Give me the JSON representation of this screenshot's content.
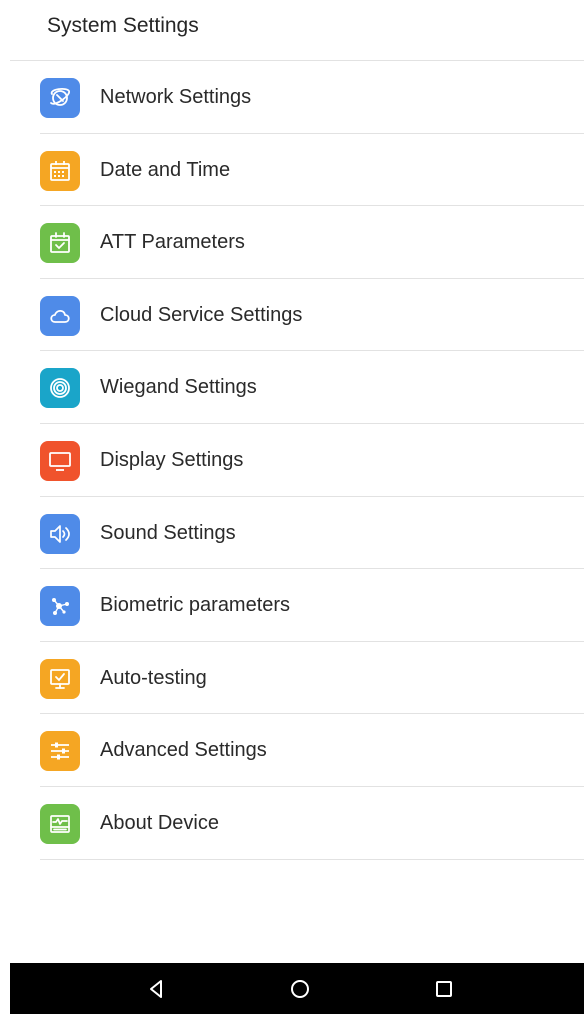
{
  "header": {
    "title": "System Settings"
  },
  "items": [
    {
      "label": "Network Settings",
      "icon": "network-icon",
      "color": "#4f8be8"
    },
    {
      "label": "Date and Time",
      "icon": "calendar-icon",
      "color": "#f5a623"
    },
    {
      "label": "ATT Parameters",
      "icon": "calendar-check-icon",
      "color": "#6fbf4a"
    },
    {
      "label": "Cloud Service Settings",
      "icon": "cloud-icon",
      "color": "#4f8be8"
    },
    {
      "label": "Wiegand Settings",
      "icon": "wiegand-icon",
      "color": "#1aa5c9"
    },
    {
      "label": "Display Settings",
      "icon": "monitor-icon",
      "color": "#f0532c"
    },
    {
      "label": "Sound Settings",
      "icon": "speaker-icon",
      "color": "#4f8be8"
    },
    {
      "label": "Biometric parameters",
      "icon": "biometric-icon",
      "color": "#4f8be8"
    },
    {
      "label": "Auto-testing",
      "icon": "auto-test-icon",
      "color": "#f5a623"
    },
    {
      "label": "Advanced Settings",
      "icon": "sliders-icon",
      "color": "#f5a623"
    },
    {
      "label": "About Device",
      "icon": "device-info-icon",
      "color": "#6fbf4a"
    }
  ],
  "navbar": {
    "back": "back-icon",
    "home": "home-icon",
    "recents": "recents-icon"
  }
}
